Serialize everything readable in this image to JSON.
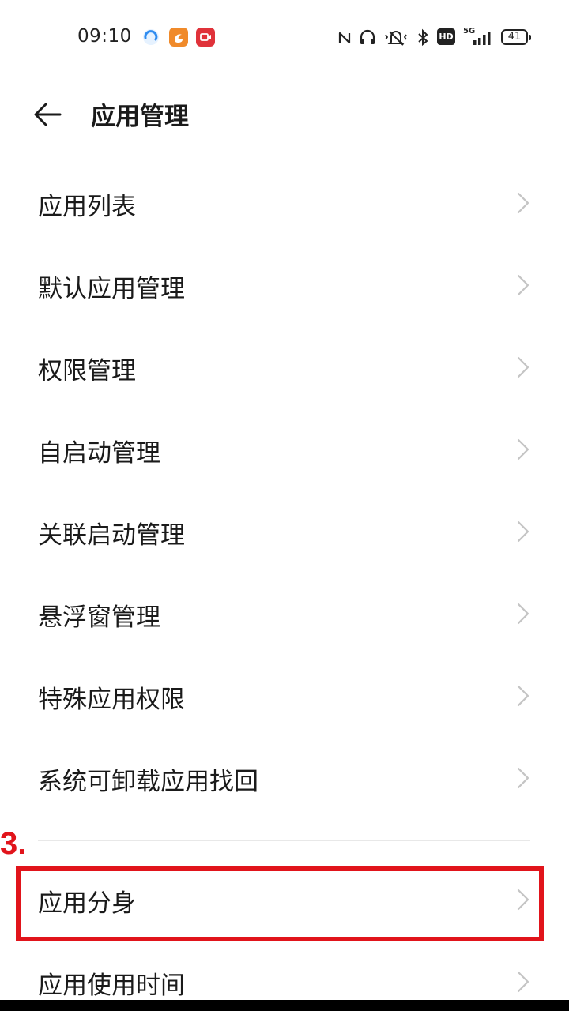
{
  "status_bar": {
    "time": "09:10",
    "icons": [
      "browser-app-icon",
      "uc-browser-app-icon",
      "screen-record-app-icon",
      "nfc-icon",
      "headphones-icon",
      "vibrate-mute-icon",
      "bluetooth-icon",
      "hd-icon",
      "signal-5g-icon",
      "battery-icon"
    ],
    "hd_label": "HD",
    "network_label": "5G",
    "battery_level": "41"
  },
  "header": {
    "title": "应用管理"
  },
  "menu_items": [
    {
      "label": "应用列表"
    },
    {
      "label": "默认应用管理"
    },
    {
      "label": "权限管理"
    },
    {
      "label": "自启动管理"
    },
    {
      "label": "关联启动管理"
    },
    {
      "label": "悬浮窗管理"
    },
    {
      "label": "特殊应用权限"
    },
    {
      "label": "系统可卸载应用找回"
    }
  ],
  "section2_items": [
    {
      "label": "应用分身"
    },
    {
      "label": "应用使用时间"
    }
  ],
  "annotation": {
    "step_label": "3.",
    "color": "#e1141b"
  }
}
